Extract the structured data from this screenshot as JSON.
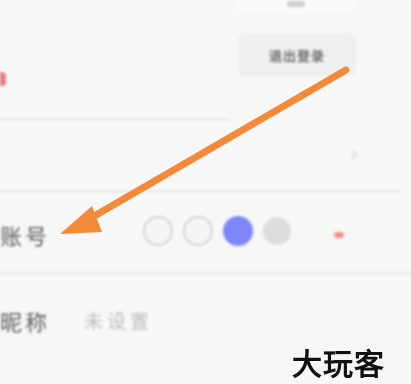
{
  "colors": {
    "background": "#f7f7f7",
    "label_text": "#5a5a5a",
    "placeholder_text": "#bcbcbc",
    "selected_color_swatch": "#7c86f4",
    "annotation_arrow": "#f28a3a",
    "accent_red": "#e87c7c"
  },
  "header": {
    "top_button_label": "退出登录"
  },
  "settings": {
    "account_row": {
      "label": "账号"
    },
    "nickname_row": {
      "label": "昵称",
      "value": "未设置"
    },
    "color_swatches": [
      "light-gray",
      "light-gray",
      "blue",
      "gray"
    ],
    "selected_swatch": "blue"
  },
  "icons": {
    "row_chevron": "chevron-right-icon",
    "annotation": "arrow-annotation-icon"
  },
  "watermark": {
    "text": "大玩客"
  }
}
